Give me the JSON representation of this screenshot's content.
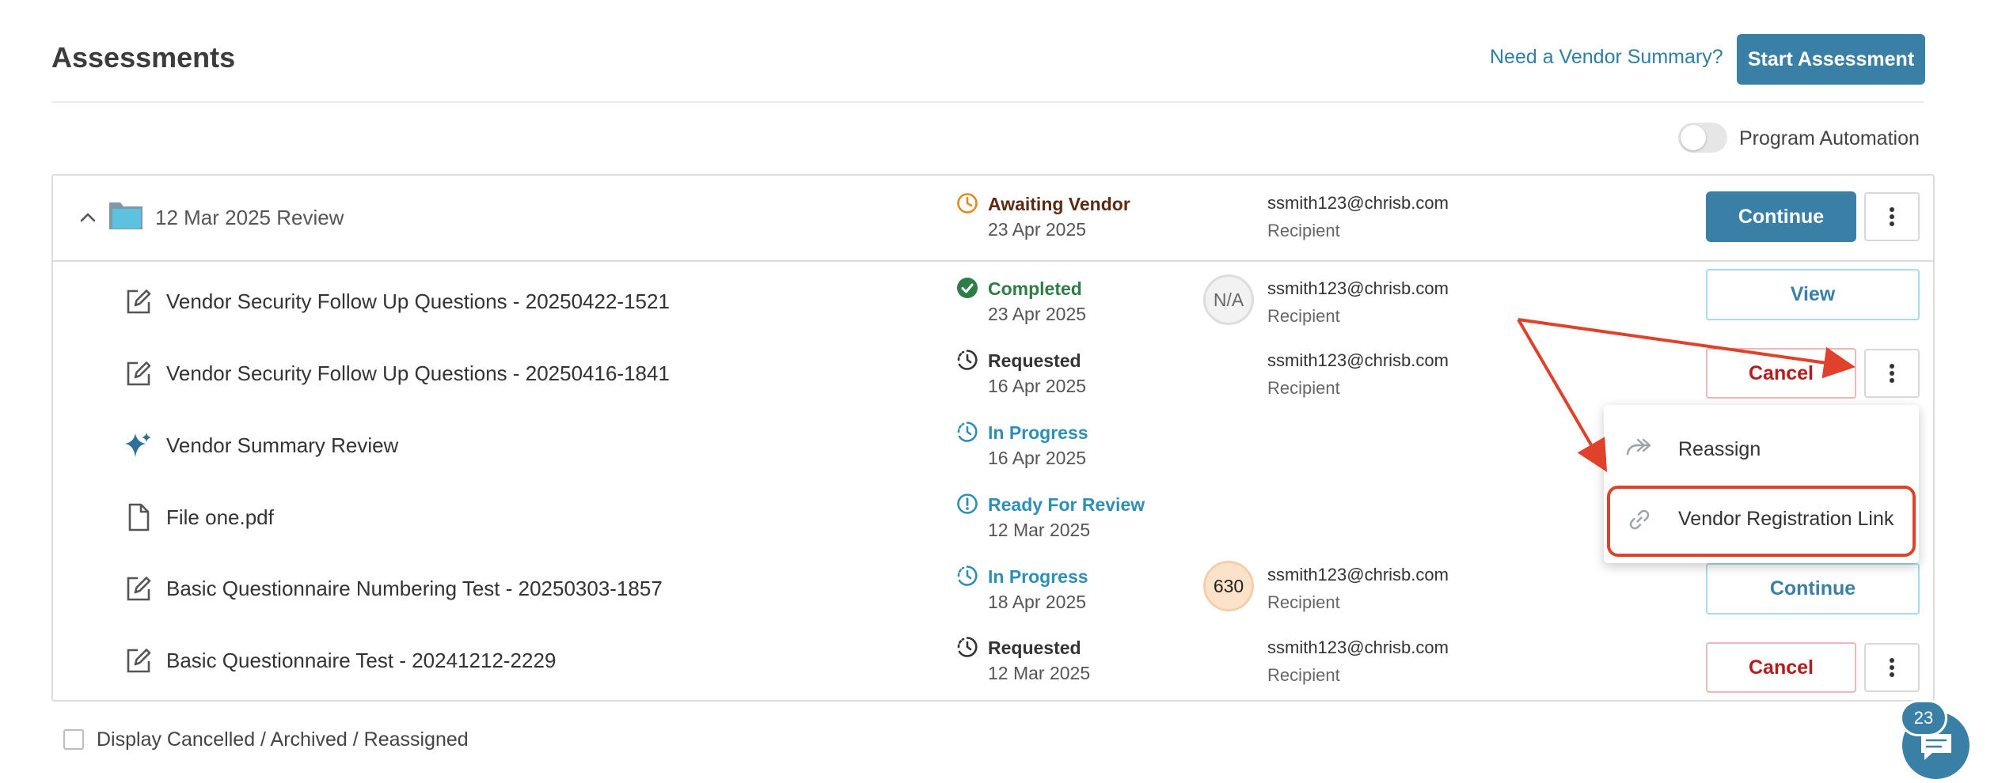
{
  "header": {
    "title": "Assessments",
    "vendor_summary_link": "Need a Vendor Summary?",
    "start_button": "Start Assessment"
  },
  "automation": {
    "label": "Program Automation",
    "enabled": false
  },
  "group": {
    "title": "12 Mar 2025 Review",
    "status": "Awaiting Vendor",
    "date": "23 Apr 2025",
    "email": "ssmith123@chrisb.com",
    "role": "Recipient",
    "action": "Continue",
    "icon": "folder-icon"
  },
  "rows": [
    {
      "title": "Vendor Security Follow Up Questions - 20250422-1521",
      "icon": "edit-icon",
      "status": "Completed",
      "status_color": "#2e7d46",
      "status_icon": "check-circle-icon",
      "date": "23 Apr 2025",
      "score": "N/A",
      "email": "ssmith123@chrisb.com",
      "role": "Recipient",
      "action": "View"
    },
    {
      "title": "Vendor Security Follow Up Questions - 20250416-1841",
      "icon": "edit-icon",
      "status": "Requested",
      "status_color": "#333333",
      "status_icon": "clock-progress-icon",
      "date": "16 Apr 2025",
      "email": "ssmith123@chrisb.com",
      "role": "Recipient",
      "action": "Cancel"
    },
    {
      "title": "Vendor Summary Review",
      "icon": "sparkle-icon",
      "status": "In Progress",
      "status_color": "#2f8fb3",
      "status_icon": "clock-progress-icon",
      "date": "16 Apr 2025"
    },
    {
      "title": "File one.pdf",
      "icon": "file-icon",
      "status": "Ready For Review",
      "status_color": "#2f8fb3",
      "status_icon": "alert-circle-icon",
      "date": "12 Mar 2025"
    },
    {
      "title": "Basic Questionnaire Numbering Test - 20250303-1857",
      "icon": "edit-icon",
      "status": "In Progress",
      "status_color": "#2f8fb3",
      "status_icon": "clock-progress-icon",
      "date": "18 Apr 2025",
      "score": "630",
      "email": "ssmith123@chrisb.com",
      "role": "Recipient",
      "action": "Continue"
    },
    {
      "title": "Basic Questionnaire Test - 20241212-2229",
      "icon": "edit-icon",
      "status": "Requested",
      "status_color": "#333333",
      "status_icon": "clock-progress-icon",
      "date": "12 Mar 2025",
      "email": "ssmith123@chrisb.com",
      "role": "Recipient",
      "action": "Cancel"
    }
  ],
  "menu": {
    "items": [
      {
        "label": "Reassign",
        "icon": "reassign-icon"
      },
      {
        "label": "Vendor Registration Link",
        "icon": "link-icon"
      }
    ]
  },
  "footer": {
    "checkbox_label": "Display Cancelled / Archived / Reassigned"
  },
  "chat": {
    "count": "23"
  },
  "colors": {
    "primary": "#3a80a6",
    "danger": "#b51c1c",
    "annotation": "#e0412a",
    "awaiting": "#e08a1e"
  }
}
